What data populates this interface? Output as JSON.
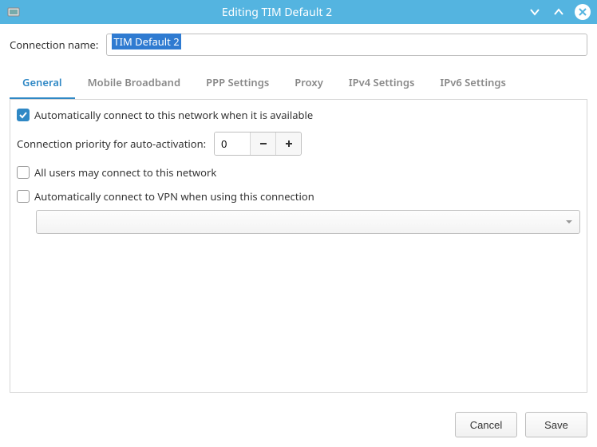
{
  "titlebar": {
    "title": "Editing TIM Default 2"
  },
  "form": {
    "connection_name_label": "Connection name:",
    "connection_name_value": "TIM Default 2"
  },
  "tabs": [
    {
      "label": "General",
      "active": true
    },
    {
      "label": "Mobile Broadband",
      "active": false
    },
    {
      "label": "PPP Settings",
      "active": false
    },
    {
      "label": "Proxy",
      "active": false
    },
    {
      "label": "IPv4 Settings",
      "active": false
    },
    {
      "label": "IPv6 Settings",
      "active": false
    }
  ],
  "general": {
    "auto_connect_label": "Automatically connect to this network when it is available",
    "auto_connect_checked": true,
    "priority_label": "Connection priority for auto-activation:",
    "priority_value": "0",
    "all_users_label": "All users may connect to this network",
    "all_users_checked": false,
    "auto_vpn_label": "Automatically connect to VPN when using this connection",
    "auto_vpn_checked": false,
    "vpn_selected": ""
  },
  "buttons": {
    "cancel": "Cancel",
    "save": "Save"
  }
}
